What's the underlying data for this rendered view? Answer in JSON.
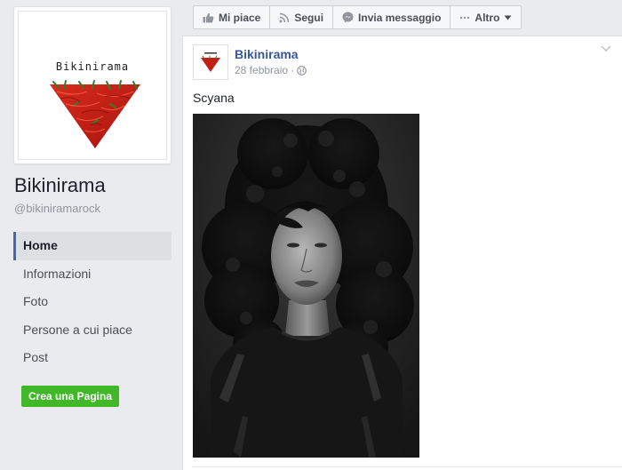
{
  "page": {
    "logo_text": "Bikinirama",
    "name": "Bikinirama",
    "handle": "@bikiniramarock"
  },
  "nav": {
    "items": [
      {
        "label": "Home",
        "active": true
      },
      {
        "label": "Informazioni"
      },
      {
        "label": "Foto"
      },
      {
        "label": "Persone a cui piace"
      },
      {
        "label": "Post"
      }
    ]
  },
  "create_page_button": "Crea una Pagina",
  "action_bar": {
    "like": "Mi piace",
    "follow": "Segui",
    "message": "Invia messaggio",
    "more": "Altro"
  },
  "post": {
    "author": "Bikinirama",
    "date": "28 febbraio",
    "separator": "·",
    "privacy_icon": "globe-icon",
    "text": "Scyana",
    "photo_subject": "black-and-white portrait"
  },
  "colors": {
    "link": "#365899",
    "create_button": "#42b72a",
    "nav_active_border": "#4267b2"
  }
}
